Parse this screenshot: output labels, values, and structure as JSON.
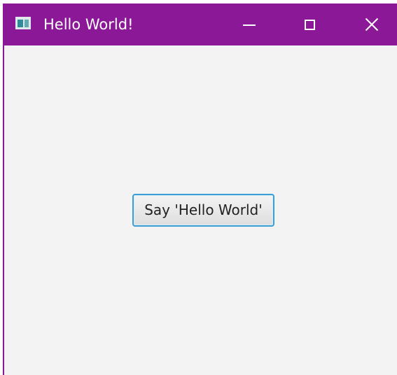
{
  "window": {
    "title": "Hello World!",
    "icons": {
      "app": "java-window-icon",
      "minimize": "minimize-icon",
      "maximize": "maximize-icon",
      "close": "close-icon"
    },
    "colors": {
      "titlebar": "#8b1897",
      "content_background": "#f3f3f3",
      "button_focus": "#3b9ed3"
    }
  },
  "main": {
    "button_label": "Say 'Hello World'"
  }
}
